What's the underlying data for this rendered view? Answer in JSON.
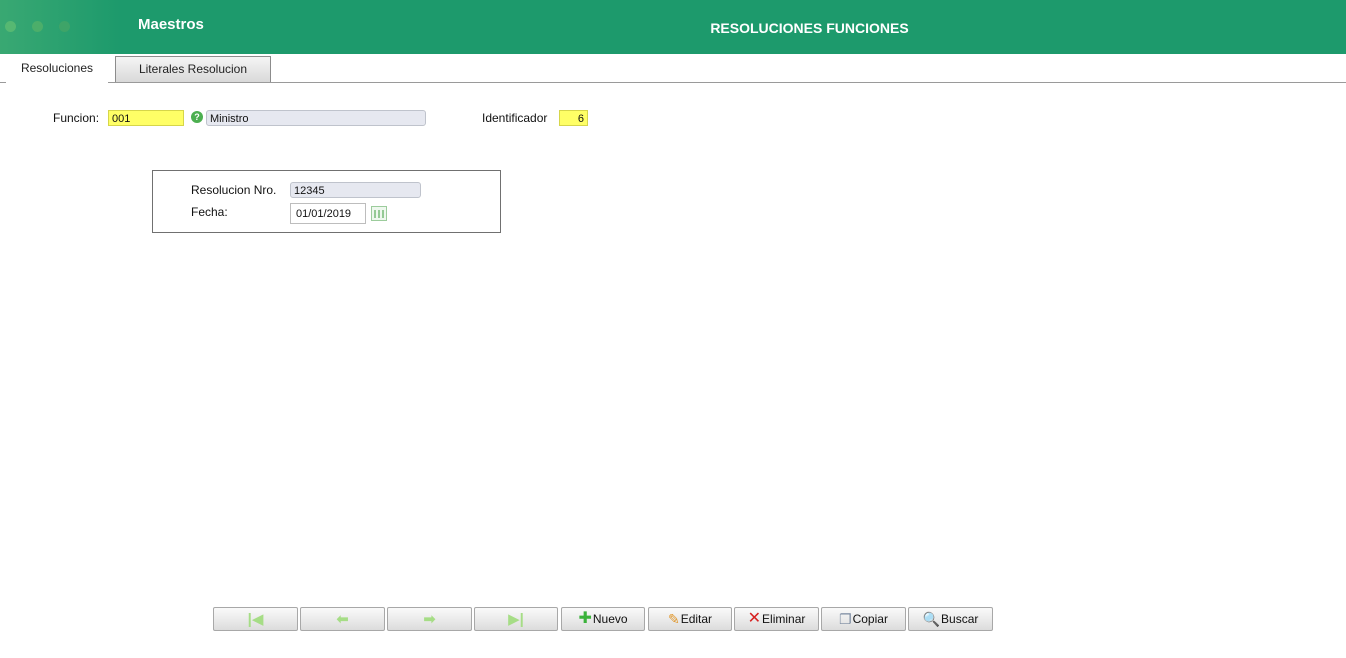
{
  "header": {
    "app_title": "Maestros",
    "page_title": "RESOLUCIONES FUNCIONES",
    "color": "#1d9a6c"
  },
  "tabs": [
    {
      "label": "Resoluciones",
      "active": true
    },
    {
      "label": "Literales Resolucion",
      "active": false
    }
  ],
  "form": {
    "funcion_label": "Funcion:",
    "funcion_code": "001",
    "funcion_name": "Ministro",
    "identificador_label": "Identificador",
    "identificador_value": "6"
  },
  "group": {
    "resolucion_label": "Resolucion Nro.",
    "resolucion_value": "12345",
    "fecha_label": "Fecha:",
    "fecha_value": "01/01/2019"
  },
  "toolbar": {
    "nuevo": "Nuevo",
    "editar": "Editar",
    "eliminar": "Eliminar",
    "copiar": "Copiar",
    "buscar": "Buscar",
    "icons": [
      "first-record-icon",
      "previous-record-icon",
      "next-record-icon",
      "last-record-icon",
      "plus-icon",
      "pencil-icon",
      "x-icon",
      "copy-icon",
      "magnifier-icon"
    ]
  }
}
